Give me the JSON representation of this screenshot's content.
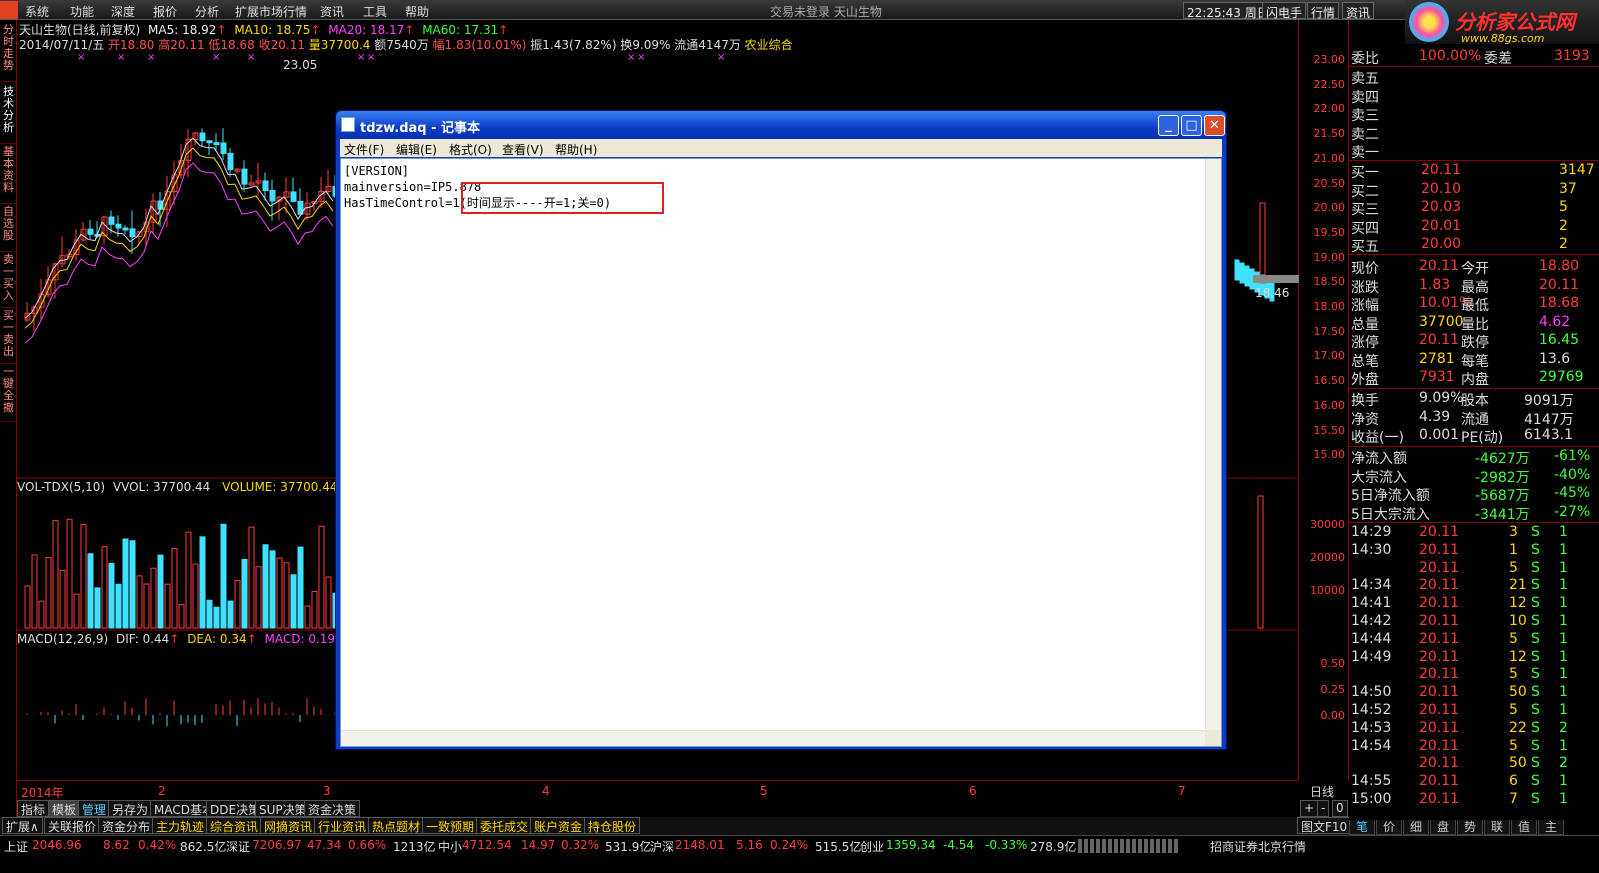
{
  "menubar": {
    "items": [
      "系统",
      "功能",
      "深度",
      "报价",
      "分析",
      "扩展市场行情",
      "资讯",
      "工具",
      "帮助"
    ],
    "center": "交易未登录   天山生物",
    "time": "22:25:43 周日",
    "buttons": [
      "闪电手",
      "行情",
      "资讯"
    ]
  },
  "brand": {
    "name": "分析家公式网",
    "url": "www.88gs.com"
  },
  "left_tabs": [
    "分时走势",
    "技术分析",
    "基本资料",
    "自选股",
    "卖一买入",
    "买一卖出",
    "一键全撤"
  ],
  "chart": {
    "title": "天山生物(日线,前复权)",
    "ma5": "MA5: 18.92",
    "ma10": "MA10: 18.75",
    "ma20": "MA20: 18.17",
    "ma60": "MA60: 17.31",
    "bar_date": "2014/07/11/五",
    "open": "开18.80",
    "high": "高20.11",
    "low": "低18.68",
    "close": "收20.11",
    "vol": "量37700.4",
    "amount": "额7540万",
    "change": "幅1.83(10.01%)",
    "amp": "振1.43(7.82%)",
    "turnover": "换9.09%",
    "float": "流通4147万",
    "sector": "农业综合",
    "peak": "23.05",
    "cur": "18.46",
    "vol_title": "VOL-TDX(5,10)",
    "vvol": "VVOL: 37700.44",
    "volume": "VOLUME: 37700.44",
    "macd_title": "MACD(12,26,9)",
    "dif": "DIF: 0.44",
    "dea": "DEA: 0.34",
    "macd": "MACD: 0.19"
  },
  "chart_data": {
    "type": "candlestick",
    "price_ticks": [
      "23.00",
      "22.50",
      "22.00",
      "21.50",
      "21.00",
      "20.50",
      "20.00",
      "19.50",
      "19.00",
      "18.50",
      "18.00",
      "17.50",
      "17.00",
      "16.50",
      "16.00",
      "15.50",
      "15.00"
    ],
    "vol_ticks": [
      "30000",
      "20000",
      "10000"
    ],
    "macd_ticks": [
      "0.50",
      "0.25",
      "0.00"
    ],
    "x_labels": [
      "2014年",
      "2",
      "3",
      "4",
      "5",
      "6",
      "7"
    ],
    "period": "日线"
  },
  "notepad": {
    "title": "tdzw.daq - 记事本",
    "menu": [
      "文件(F)",
      "编辑(E)",
      "格式(O)",
      "查看(V)",
      "帮助(H)"
    ],
    "content": "[VERSION]\nmainversion=IP5.878\nHasTimeControl=1(时间显示----开=1;关=0)"
  },
  "quote": {
    "weibi": {
      "l": "委比",
      "v": "100.00%",
      "l2": "委差",
      "v2": "3193"
    },
    "sells": [
      "卖五",
      "卖四",
      "卖三",
      "卖二",
      "卖一"
    ],
    "buys": [
      [
        "买一",
        "20.11",
        "3147"
      ],
      [
        "买二",
        "20.10",
        "37"
      ],
      [
        "买三",
        "20.03",
        "5"
      ],
      [
        "买四",
        "20.01",
        "2"
      ],
      [
        "买五",
        "20.00",
        "2"
      ]
    ],
    "stats": [
      [
        "现价",
        "20.11",
        "今开",
        "18.80"
      ],
      [
        "涨跌",
        "1.83",
        "最高",
        "20.11"
      ],
      [
        "涨幅",
        "10.01%",
        "最低",
        "18.68"
      ],
      [
        "总量",
        "37700",
        "量比",
        "4.62"
      ],
      [
        "涨停",
        "20.11",
        "跌停",
        "16.45"
      ],
      [
        "总笔",
        "2781",
        "每笔",
        "13.6"
      ],
      [
        "外盘",
        "7931",
        "内盘",
        "29769"
      ]
    ],
    "stats2": [
      [
        "换手",
        "9.09%",
        "股本",
        "9091万"
      ],
      [
        "净资",
        "4.39",
        "流通",
        "4147万"
      ],
      [
        "收益(一)",
        "0.001",
        "PE(动)",
        "6143.1"
      ]
    ],
    "flows": [
      [
        "净流入额",
        "-4627万",
        "-61%"
      ],
      [
        "大宗流入",
        "-2982万",
        "-40%"
      ],
      [
        "5日净流入额",
        "-5687万",
        "-45%"
      ],
      [
        "5日大宗流入",
        "-3441万",
        "-27%"
      ]
    ],
    "ticks": [
      [
        "14:29",
        "20.11",
        "3",
        "S",
        "1"
      ],
      [
        "14:30",
        "20.11",
        "1",
        "S",
        "1"
      ],
      [
        "",
        "20.11",
        "5",
        "S",
        "1"
      ],
      [
        "14:34",
        "20.11",
        "21",
        "S",
        "1"
      ],
      [
        "14:41",
        "20.11",
        "12",
        "S",
        "1"
      ],
      [
        "14:42",
        "20.11",
        "10",
        "S",
        "1"
      ],
      [
        "14:44",
        "20.11",
        "5",
        "S",
        "1"
      ],
      [
        "14:49",
        "20.11",
        "12",
        "S",
        "1"
      ],
      [
        "",
        "20.11",
        "5",
        "S",
        "1"
      ],
      [
        "14:50",
        "20.11",
        "50",
        "S",
        "1"
      ],
      [
        "14:52",
        "20.11",
        "5",
        "S",
        "1"
      ],
      [
        "14:53",
        "20.11",
        "22",
        "S",
        "2"
      ],
      [
        "14:54",
        "20.11",
        "5",
        "S",
        "1"
      ],
      [
        "",
        "20.11",
        "50",
        "S",
        "2"
      ],
      [
        "14:55",
        "20.11",
        "6",
        "S",
        "1"
      ],
      [
        "15:00",
        "20.11",
        "7",
        "S",
        "1"
      ]
    ]
  },
  "tabs1": [
    "指标",
    "模板",
    "管理",
    "另存为",
    "MACD基本",
    "DDE决策",
    "SUP决策",
    "资金决策"
  ],
  "tabs2": [
    "扩展∧",
    "关联报价",
    "资金分布",
    "主力轨迹",
    "综合资讯",
    "网摘资讯",
    "行业资讯",
    "热点题材",
    "一致预期",
    "委托成交",
    "账户资金",
    "持仓股份"
  ],
  "zoom": [
    "+",
    "-",
    "0"
  ],
  "rtabs": [
    "笔",
    "价",
    "细",
    "盘",
    "势",
    "联",
    "值",
    "主"
  ],
  "tufen": "图文F10",
  "status": {
    "sh": "上证",
    "sh_v": "2046.96",
    "sh_c": "8.62",
    "sh_p": "0.42%",
    "sh_a": "862.5亿",
    "sz": "深证",
    "sz_v": "7206.97",
    "sz_c": "47.34",
    "sz_p": "0.66%",
    "sz_a": "1213亿",
    "zx": "中小",
    "zx_v": "4712.54",
    "zx_c": "14.97",
    "zx_p": "0.32%",
    "zx_a": "531.9亿",
    "hs": "沪深",
    "hs_v": "2148.01",
    "hs_c": "5.16",
    "hs_p": "0.24%",
    "hs_a": "515.5亿",
    "cy": "创业",
    "cy_v": "1359.34",
    "cy_c": "-4.54",
    "cy_p": "-0.33%",
    "cy_a": "278.9亿",
    "broker": "招商证券北京行情"
  }
}
